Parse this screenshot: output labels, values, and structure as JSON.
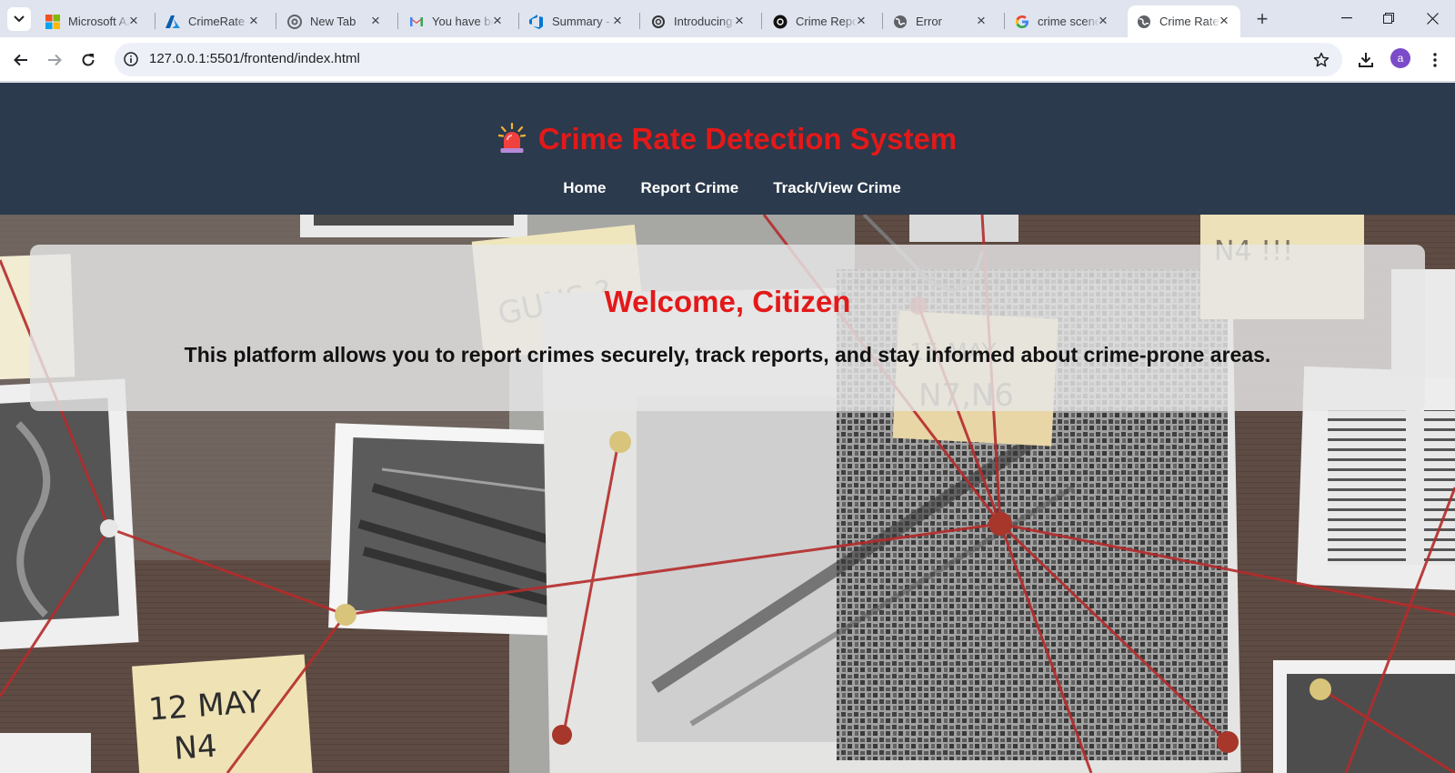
{
  "browser": {
    "tabs": [
      {
        "title": "Microsoft Azure",
        "icon": "microsoft-icon"
      },
      {
        "title": "CrimeRate - Azure",
        "icon": "azure-icon"
      },
      {
        "title": "New Tab",
        "icon": "chrome-icon"
      },
      {
        "title": "You have been",
        "icon": "gmail-icon"
      },
      {
        "title": "Summary - Azure",
        "icon": "azure-devops-icon"
      },
      {
        "title": "Introducing",
        "icon": "openai-icon"
      },
      {
        "title": "Crime Report",
        "icon": "openai-icon"
      },
      {
        "title": "Error",
        "icon": "globe-icon"
      },
      {
        "title": "crime scene",
        "icon": "google-icon"
      },
      {
        "title": "Crime Rate",
        "icon": "globe-icon",
        "active": true
      }
    ],
    "url": "127.0.0.1:5501/frontend/index.html",
    "profile_initial": "a"
  },
  "site": {
    "title": "Crime Rate Detection System",
    "nav": [
      "Home",
      "Report Crime",
      "Track/View Crime"
    ]
  },
  "hero": {
    "heading": "Welcome, Citizen",
    "text": "This platform allows you to report crimes securely, track reports, and stay informed about crime-prone areas."
  },
  "colors": {
    "header_bg": "#2b3a4c",
    "accent_red": "#e31919"
  }
}
